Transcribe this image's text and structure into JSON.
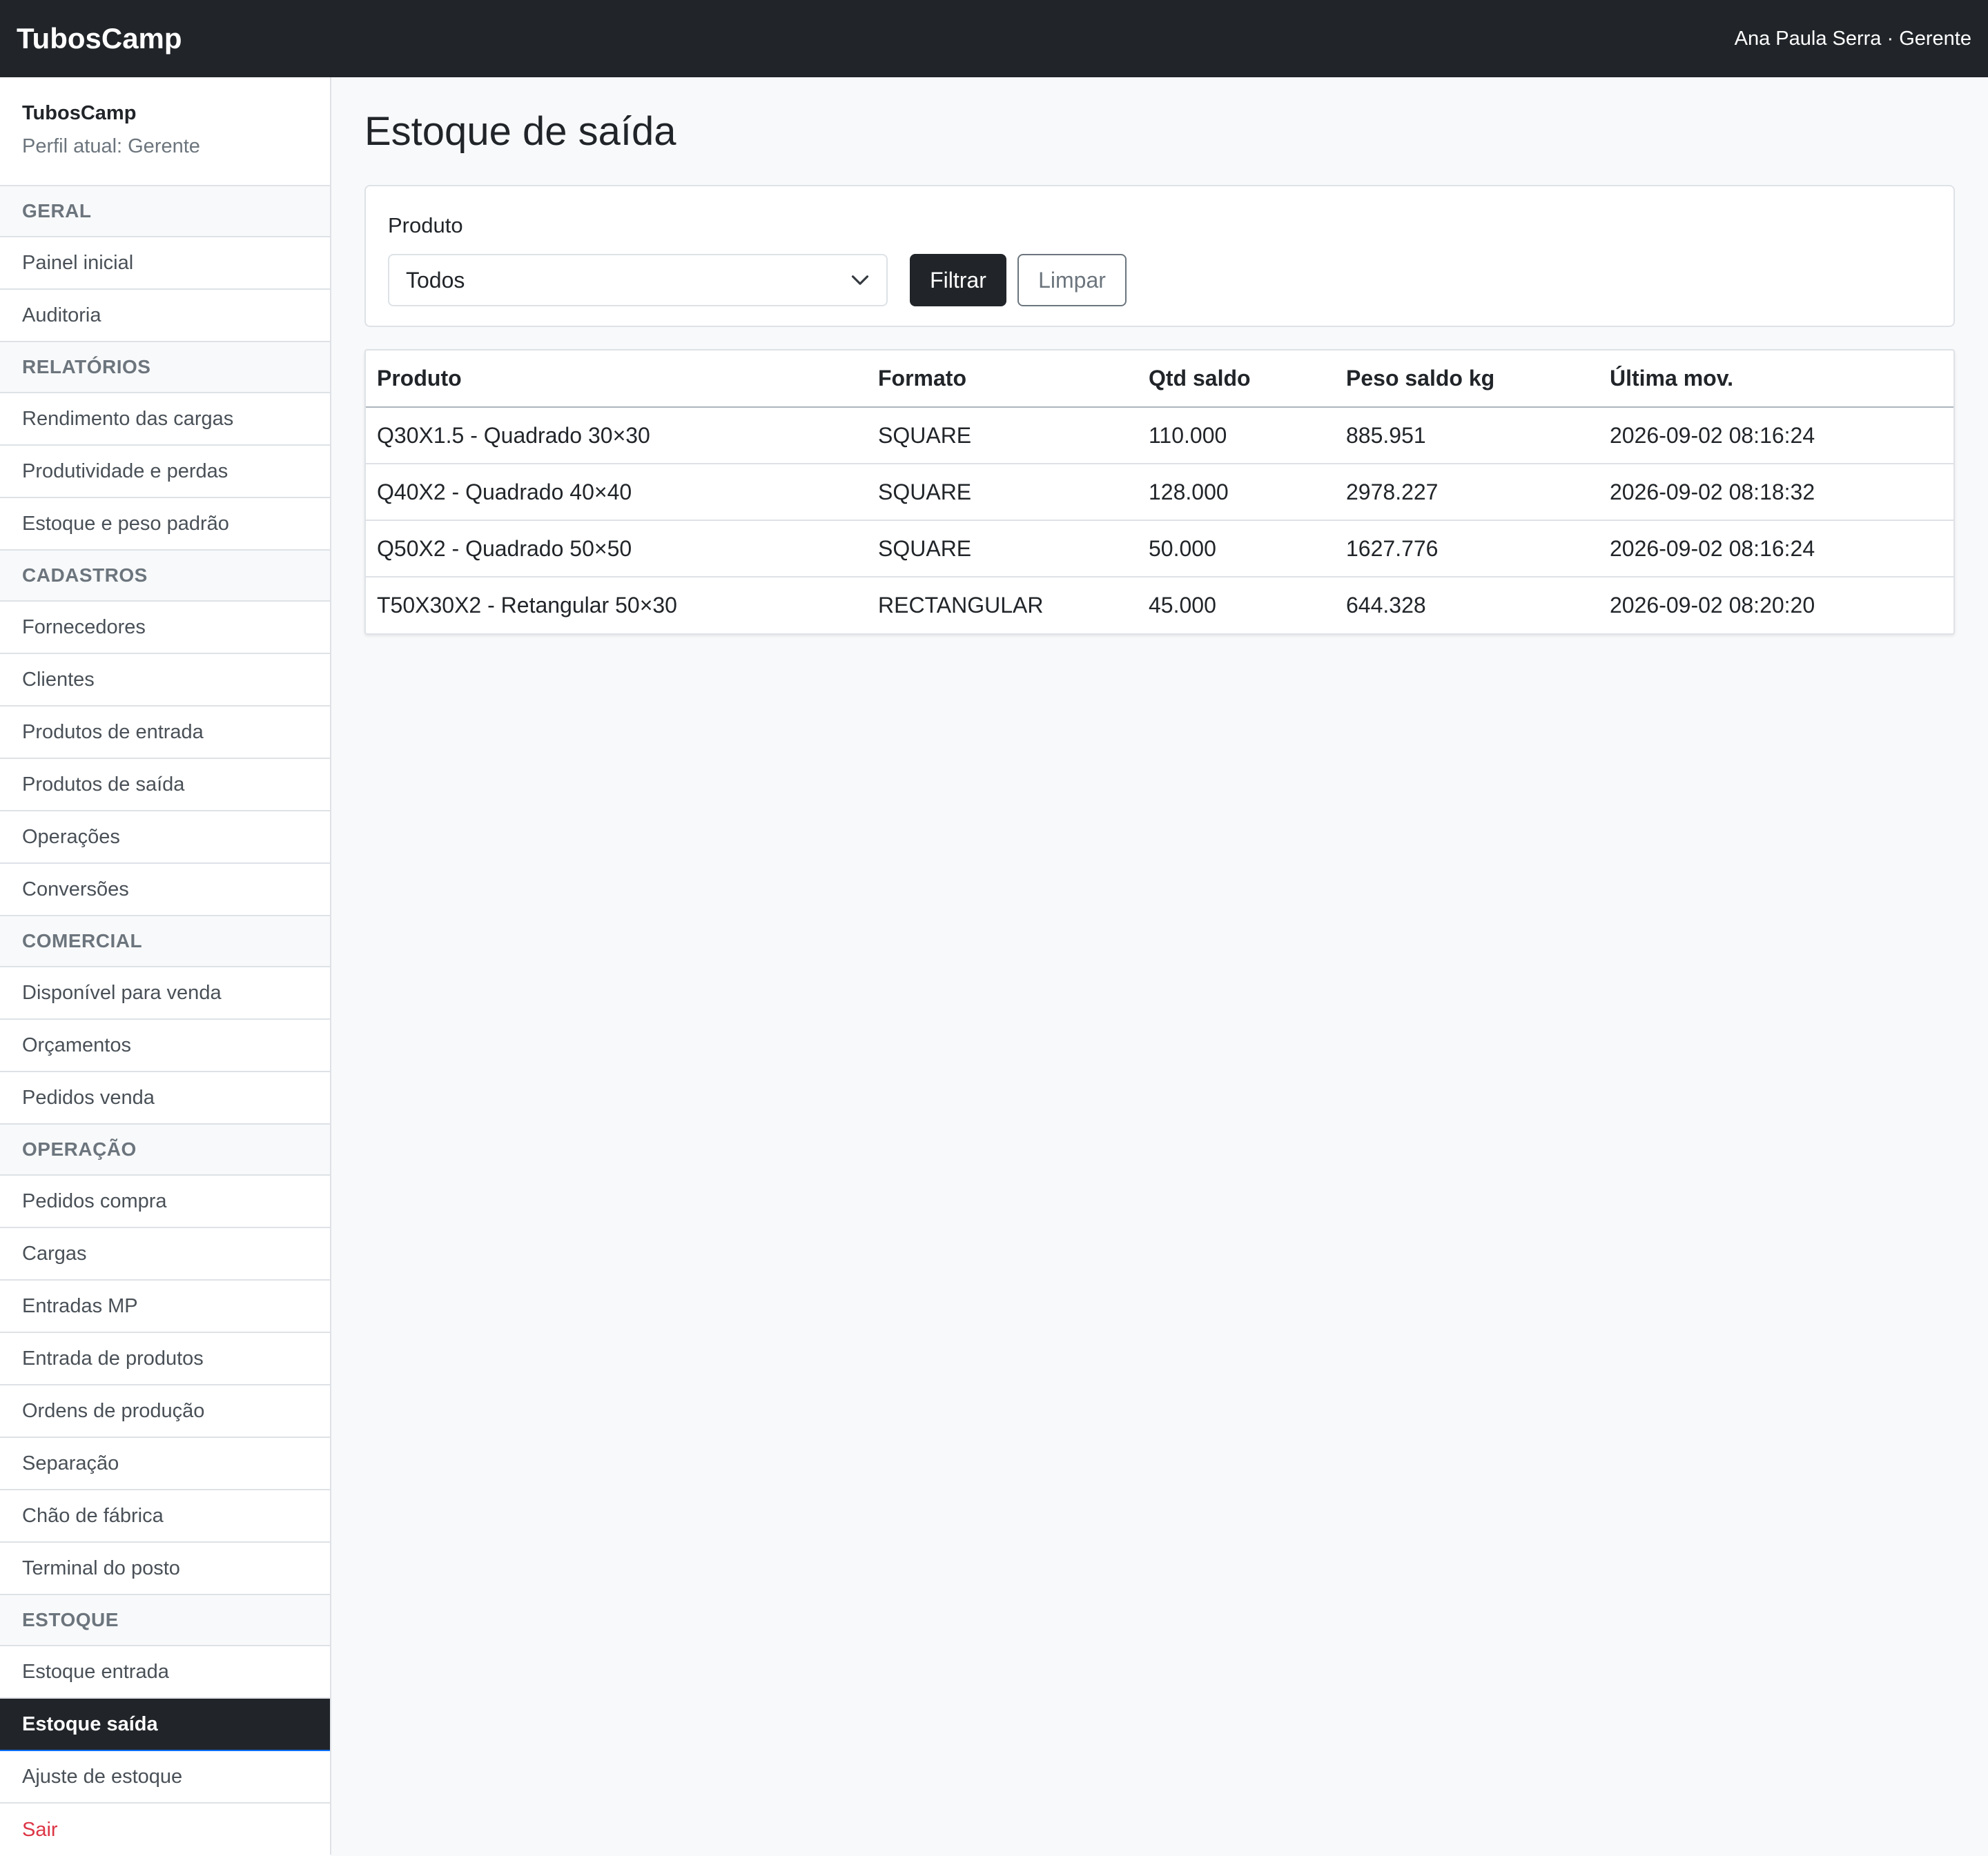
{
  "topbar": {
    "brand": "TubosCamp",
    "user": "Ana Paula Serra · Gerente"
  },
  "sidebar": {
    "app_name": "TubosCamp",
    "profile": "Perfil atual: Gerente",
    "sections": [
      {
        "title": "GERAL",
        "items": [
          "Painel inicial",
          "Auditoria"
        ]
      },
      {
        "title": "RELATÓRIOS",
        "items": [
          "Rendimento das cargas",
          "Produtividade e perdas",
          "Estoque e peso padrão"
        ]
      },
      {
        "title": "CADASTROS",
        "items": [
          "Fornecedores",
          "Clientes",
          "Produtos de entrada",
          "Produtos de saída",
          "Operações",
          "Conversões"
        ]
      },
      {
        "title": "COMERCIAL",
        "items": [
          "Disponível para venda",
          "Orçamentos",
          "Pedidos venda"
        ]
      },
      {
        "title": "OPERAÇÃO",
        "items": [
          "Pedidos compra",
          "Cargas",
          "Entradas MP",
          "Entrada de produtos",
          "Ordens de produção",
          "Separação",
          "Chão de fábrica",
          "Terminal do posto"
        ]
      },
      {
        "title": "ESTOQUE",
        "items": [
          "Estoque entrada",
          "Estoque saída",
          "Ajuste de estoque"
        ]
      }
    ],
    "active_item": "Estoque saída",
    "logout": "Sair"
  },
  "main": {
    "title": "Estoque de saída",
    "filter": {
      "label": "Produto",
      "selected": "Todos",
      "filter_button": "Filtrar",
      "clear_button": "Limpar"
    },
    "table": {
      "headers": [
        "Produto",
        "Formato",
        "Qtd saldo",
        "Peso saldo kg",
        "Última mov."
      ],
      "rows": [
        [
          "Q30X1.5 - Quadrado 30×30",
          "SQUARE",
          "110.000",
          "885.951",
          "2026-09-02 08:16:24"
        ],
        [
          "Q40X2 - Quadrado 40×40",
          "SQUARE",
          "128.000",
          "2978.227",
          "2026-09-02 08:18:32"
        ],
        [
          "Q50X2 - Quadrado 50×50",
          "SQUARE",
          "50.000",
          "1627.776",
          "2026-09-02 08:16:24"
        ],
        [
          "T50X30X2 - Retangular 50×30",
          "RECTANGULAR",
          "45.000",
          "644.328",
          "2026-09-02 08:20:20"
        ]
      ]
    }
  },
  "colors": {
    "dark": "#212529",
    "danger": "#dc3545",
    "muted": "#6c757d",
    "active_border": "#0d6efd"
  },
  "icons": {
    "select_caret": "chevron-down-icon"
  }
}
